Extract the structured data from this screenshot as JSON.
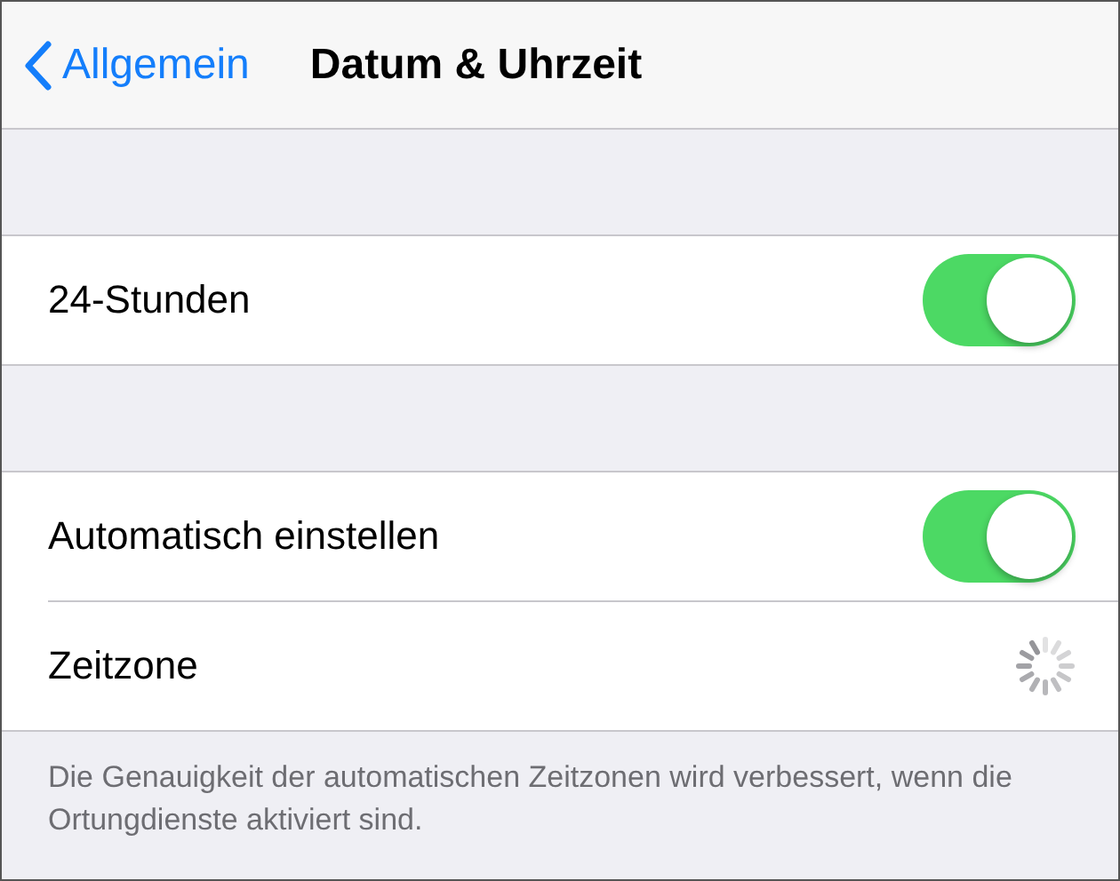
{
  "nav": {
    "back": "Allgemein",
    "title": "Datum & Uhrzeit"
  },
  "sections": [
    {
      "rows": [
        {
          "kind": "toggle",
          "label": "24-Stunden",
          "on": true
        }
      ]
    },
    {
      "rows": [
        {
          "kind": "toggle",
          "label": "Automatisch einstellen",
          "on": true
        },
        {
          "kind": "spinner",
          "label": "Zeitzone"
        }
      ],
      "footer": "Die Genauigkeit der automatischen Zeitzonen wird verbessert, wenn die Ortungdienste aktiviert sind."
    }
  ]
}
